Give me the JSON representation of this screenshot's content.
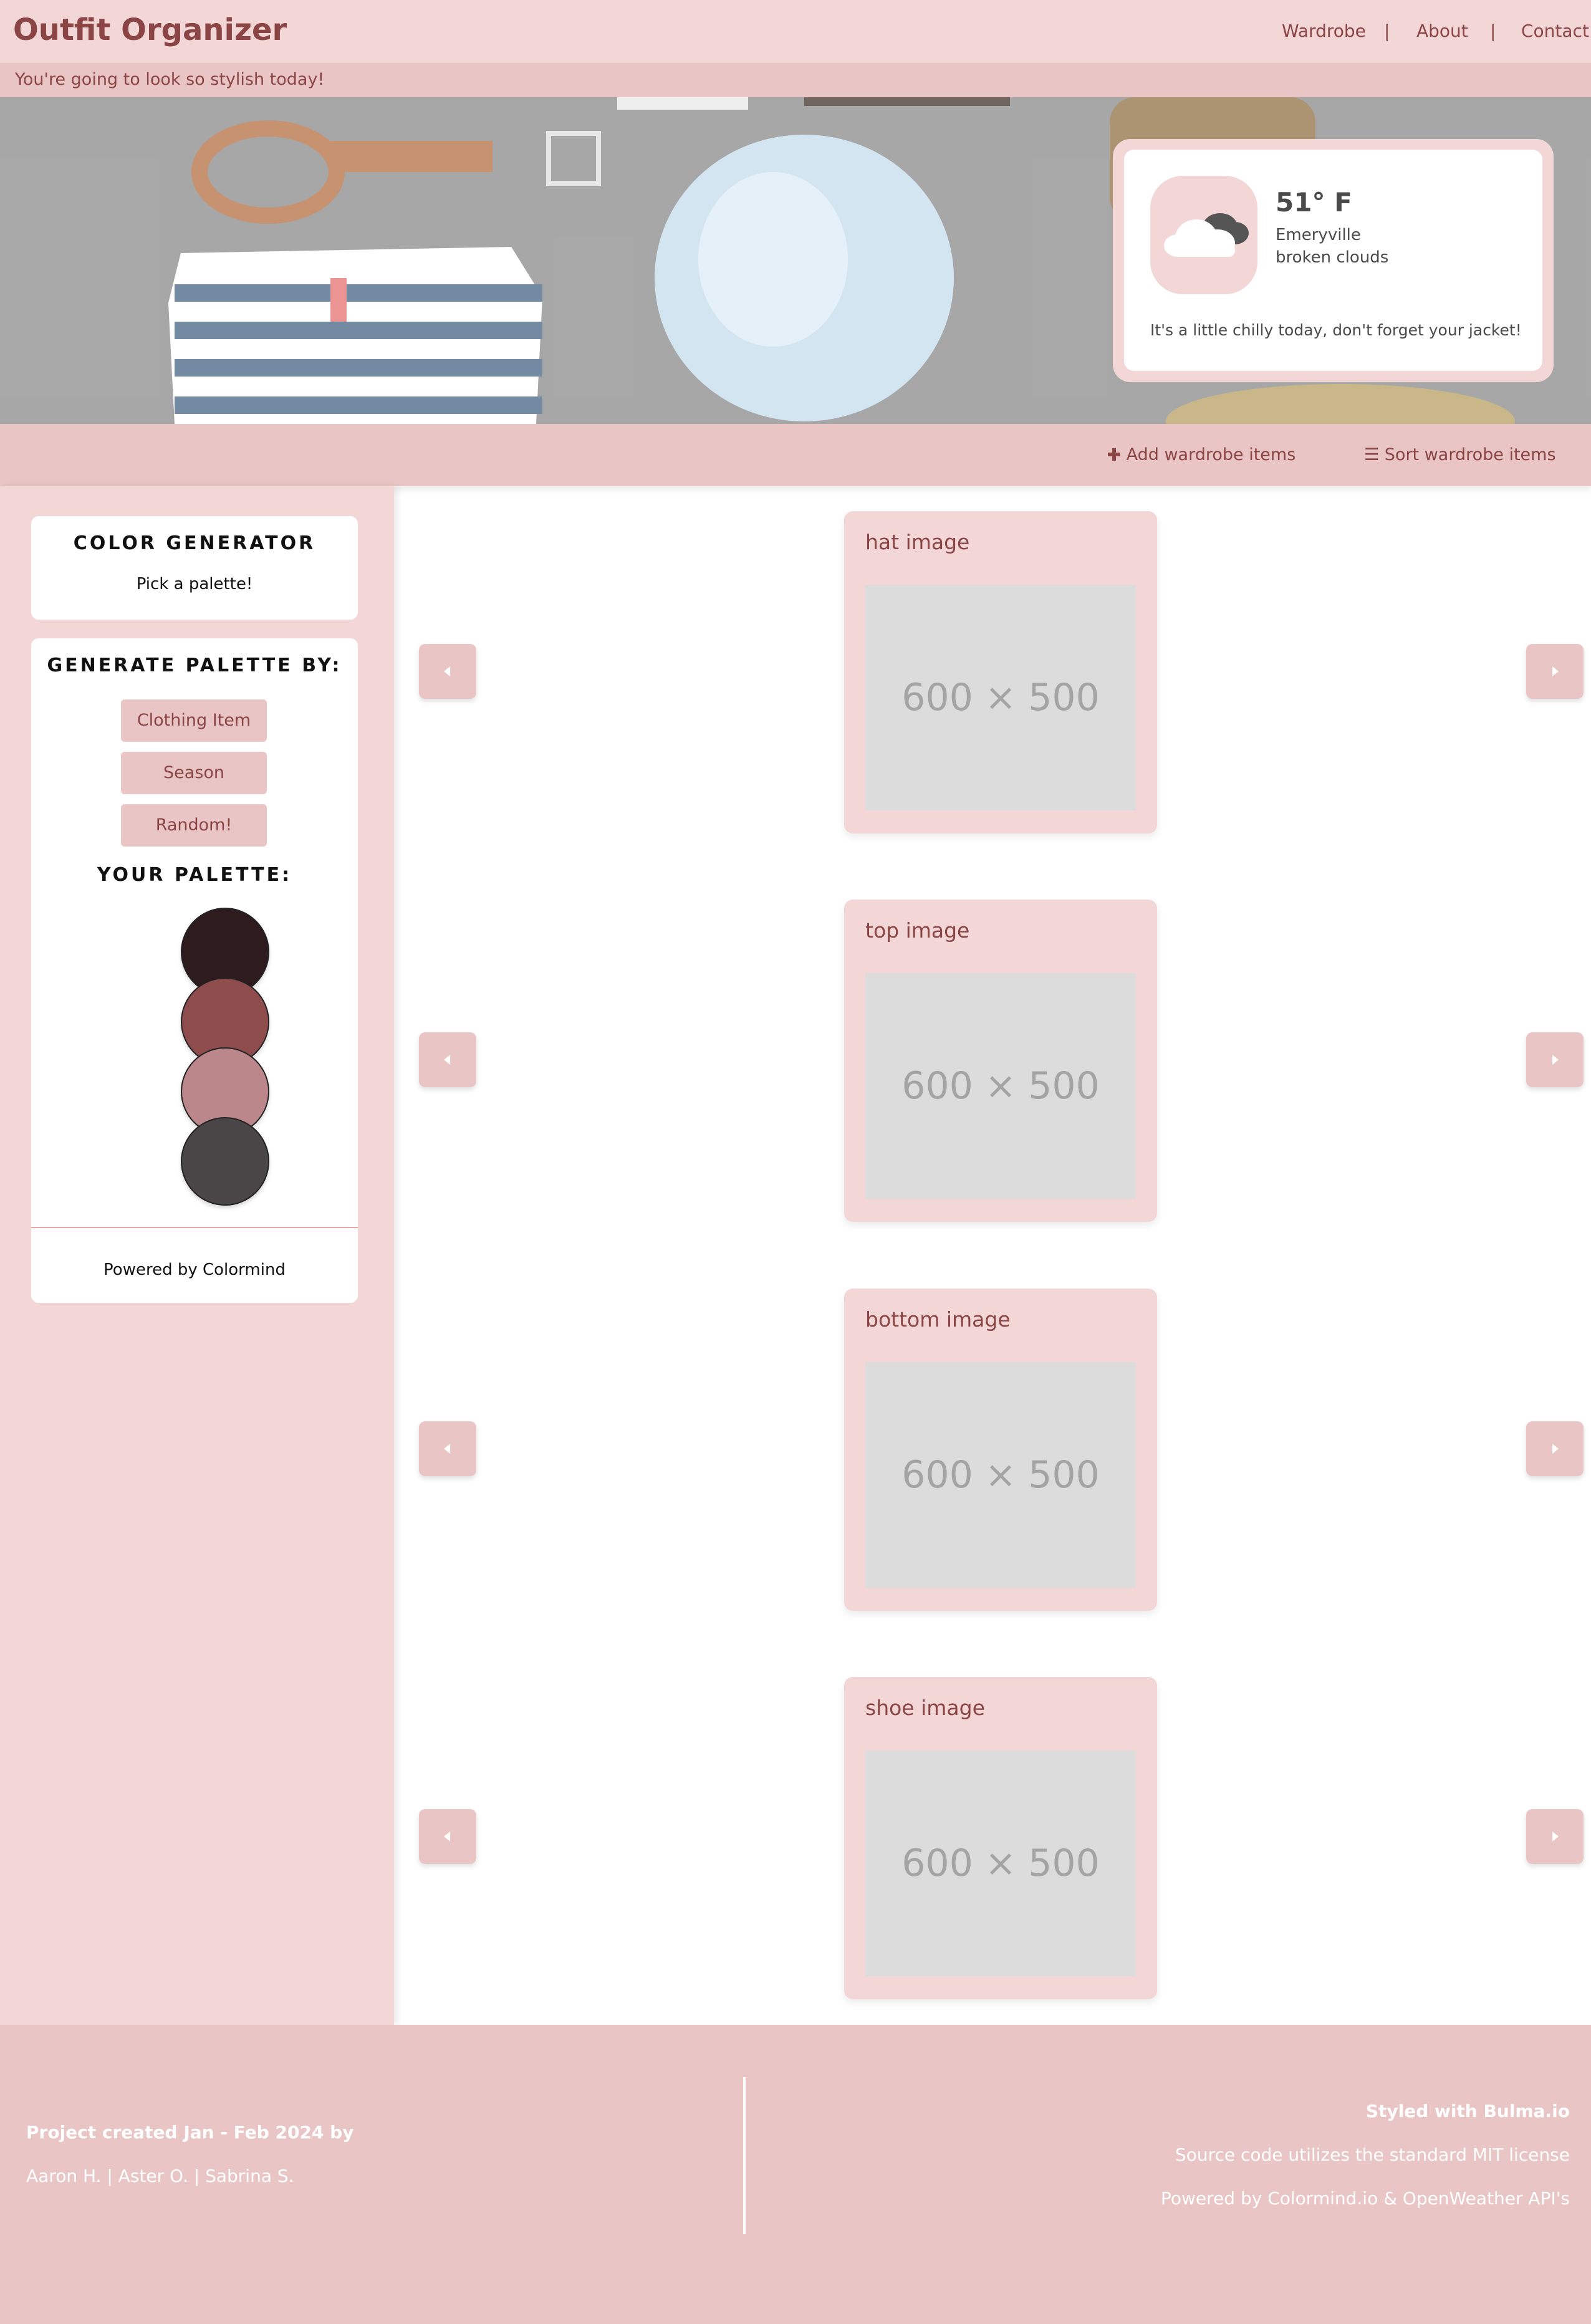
{
  "navbar": {
    "brand": "Outfit Organizer",
    "links": [
      "Wardrobe",
      "About",
      "Contact"
    ],
    "separator": "|"
  },
  "tagline": "You're going to look so stylish today!",
  "weather": {
    "icon": "cloud-icon",
    "temperature": "51° F",
    "city": "Emeryville",
    "conditions": "broken clouds",
    "advice": "It's a little chilly today, don't forget your jacket!"
  },
  "actions": {
    "add": "Add wardrobe items",
    "sort": "☰ Sort wardrobe items"
  },
  "color_generator": {
    "title": "COLOR GENERATOR",
    "subtitle": "Pick a palette!"
  },
  "generate": {
    "title": "GENERATE PALETTE BY:",
    "buttons": [
      "Clothing Item",
      "Season",
      "Random!"
    ],
    "palette_title": "YOUR PALETTE:",
    "palette": [
      "#2e1b1e",
      "#8e4c4c",
      "#bb878b",
      "#4a4547"
    ],
    "powered": "Powered by Colormind"
  },
  "carousels": [
    {
      "title": "hat image",
      "placeholder": "600 × 500"
    },
    {
      "title": "top image",
      "placeholder": "600 × 500"
    },
    {
      "title": "bottom image",
      "placeholder": "600 × 500"
    },
    {
      "title": "shoe image",
      "placeholder": "600 × 500"
    }
  ],
  "footer": {
    "credit_title": "Project created Jan - Feb 2024 by",
    "authors": "Aaron H. | Aster O. | Sabrina S.",
    "styled": "Styled with Bulma.io",
    "license": "Source code utilizes the standard MIT license",
    "powered": "Powered by Colormind.io & OpenWeather API's"
  },
  "colors": {
    "primary": "#8c4545",
    "light_pink": "#f3d7d7",
    "pink": "#e9c5c5"
  }
}
